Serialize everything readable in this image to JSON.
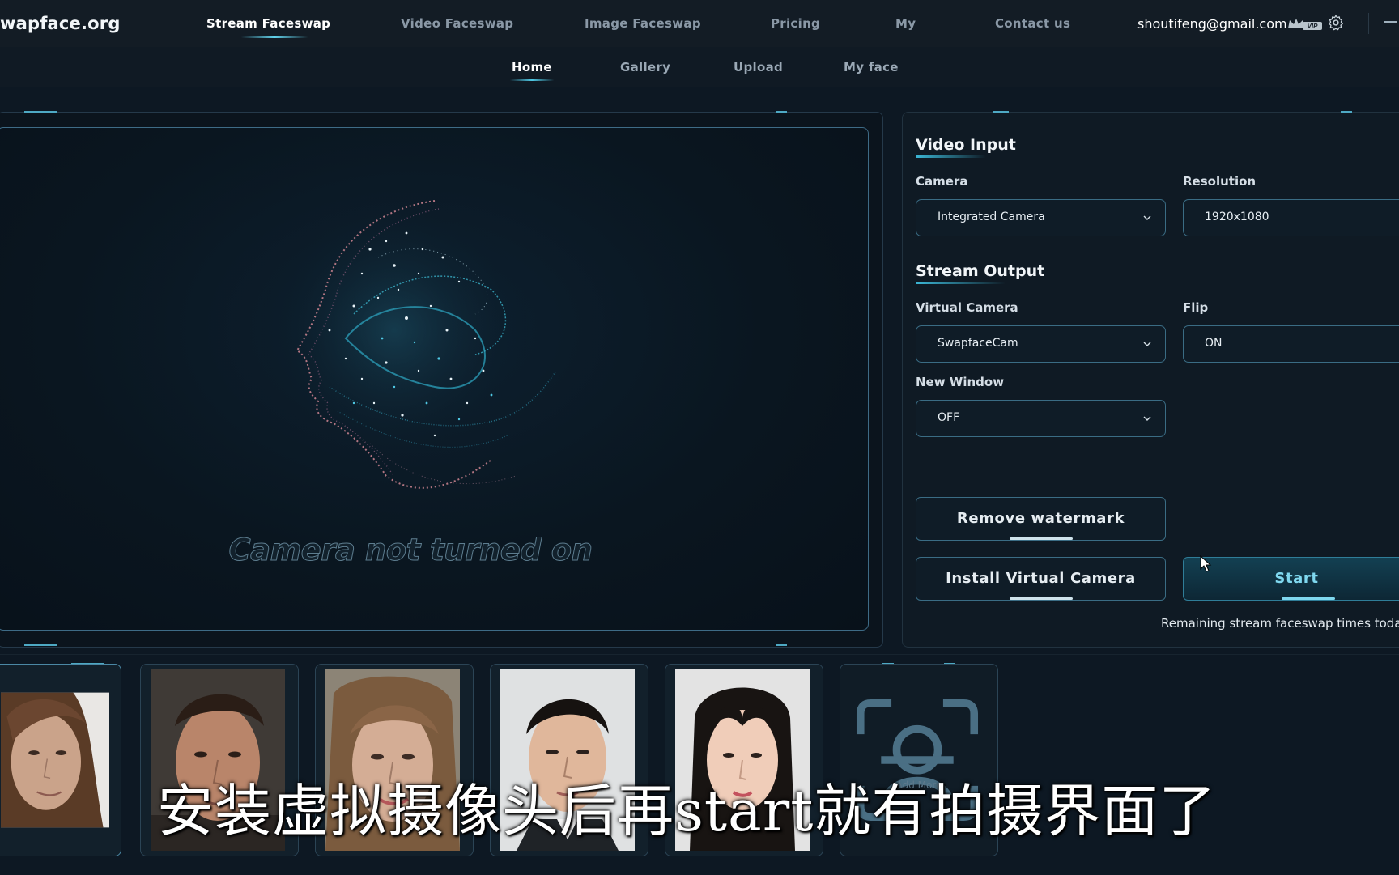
{
  "brand": {
    "logo": "wapface.org"
  },
  "topnav": {
    "items": [
      {
        "label": "Stream Faceswap",
        "active": true
      },
      {
        "label": "Video Faceswap",
        "active": false
      },
      {
        "label": "Image Faceswap",
        "active": false
      },
      {
        "label": "Pricing",
        "active": false
      },
      {
        "label": "My",
        "active": false
      },
      {
        "label": "Contact us",
        "active": false
      }
    ],
    "user_email": "shoutifeng@gmail.com",
    "vip_badge": "VIP"
  },
  "subnav": {
    "items": [
      {
        "label": "Home",
        "active": true
      },
      {
        "label": "Gallery",
        "active": false
      },
      {
        "label": "Upload",
        "active": false
      },
      {
        "label": "My face",
        "active": false
      }
    ]
  },
  "preview": {
    "status_text": "Camera not turned on"
  },
  "settings": {
    "video_input": {
      "title": "Video Input",
      "camera_label": "Camera",
      "camera_value": "Integrated Camera",
      "resolution_label": "Resolution",
      "resolution_value": "1920x1080"
    },
    "stream_output": {
      "title": "Stream Output",
      "virtual_camera_label": "Virtual Camera",
      "virtual_camera_value": "SwapfaceCam",
      "flip_label": "Flip",
      "flip_value": "ON",
      "new_window_label": "New Window",
      "new_window_value": "OFF"
    },
    "buttons": {
      "remove_watermark": "Remove watermark",
      "install_virtual_camera": "Install Virtual Camera",
      "start": "Start"
    },
    "remaining_text": "Remaining stream faceswap times toda"
  },
  "faces": {
    "add_more_label": "Add More"
  },
  "subtitle": "安装虚拟摄像头后再start就有拍摄界面了",
  "colors": {
    "background": "#0d1823",
    "accent": "#4fc8e4",
    "panel_border": "#3a6c84",
    "start_text": "#7fd8ef"
  },
  "icons": [
    "vip-crown-icon",
    "gear-icon",
    "minimize-icon",
    "chevron-down-icon",
    "face-scan-icon",
    "mouse-cursor-icon"
  ]
}
